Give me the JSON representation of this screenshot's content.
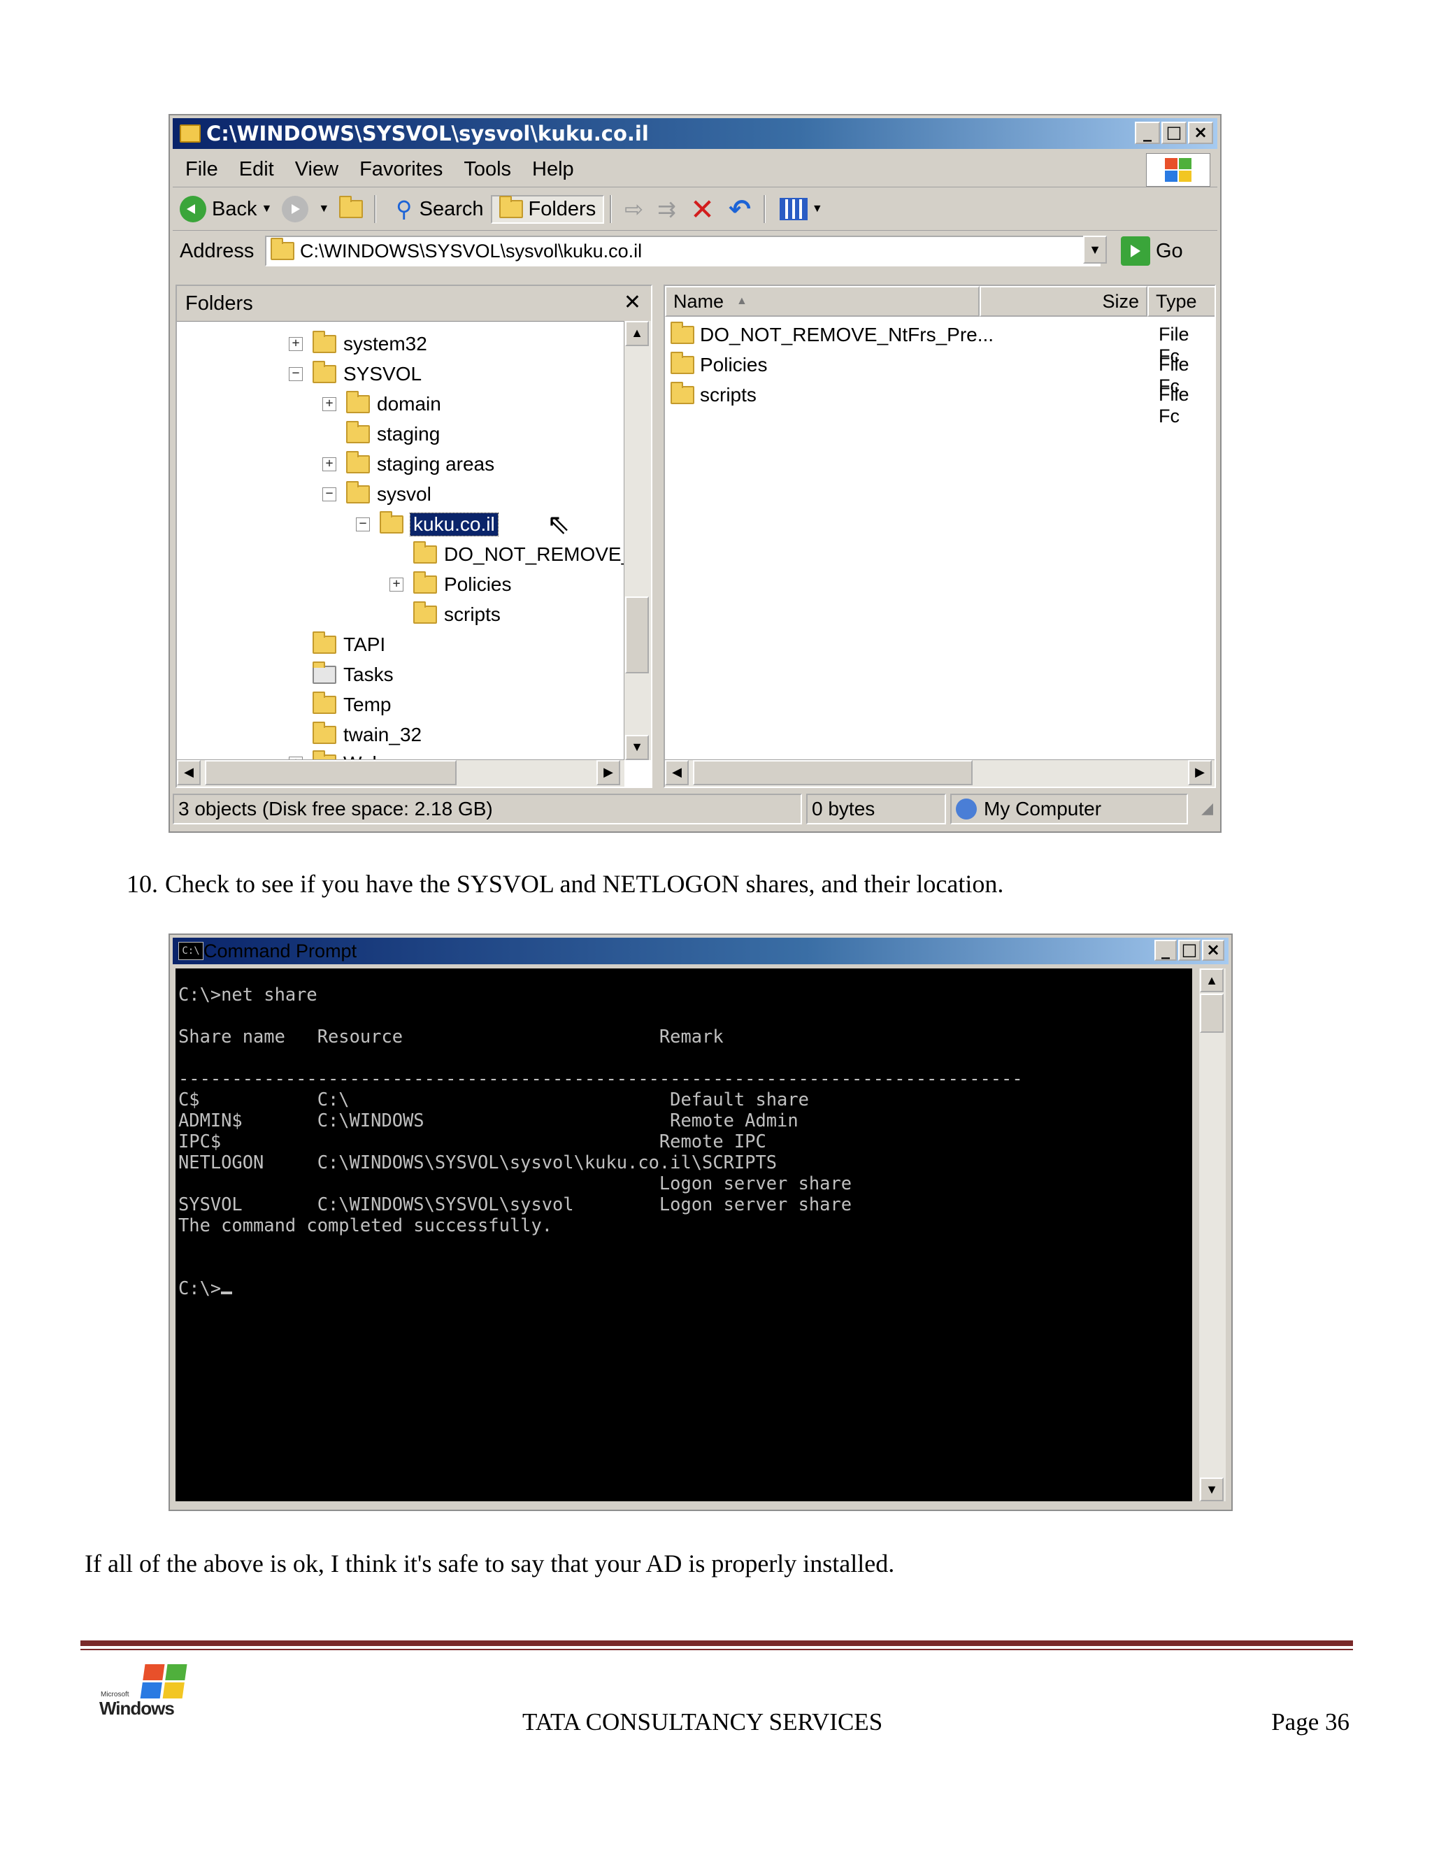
{
  "explorer": {
    "title": "C:\\WINDOWS\\SYSVOL\\sysvol\\kuku.co.il",
    "menu": [
      "File",
      "Edit",
      "View",
      "Favorites",
      "Tools",
      "Help"
    ],
    "toolbar": {
      "back": "Back",
      "search": "Search",
      "folders": "Folders"
    },
    "address_label": "Address",
    "address_value": "C:\\WINDOWS\\SYSVOL\\sysvol\\kuku.co.il",
    "go": "Go",
    "folders_header": "Folders",
    "tree": [
      {
        "label": "system32",
        "expander": "+"
      },
      {
        "label": "SYSVOL",
        "expander": "−"
      },
      {
        "label": "domain",
        "expander": "+"
      },
      {
        "label": "staging",
        "expander": ""
      },
      {
        "label": "staging areas",
        "expander": "+"
      },
      {
        "label": "sysvol",
        "expander": "−"
      },
      {
        "label": "kuku.co.il",
        "expander": "−",
        "selected": true
      },
      {
        "label": "DO_NOT_REMOVE_I",
        "expander": ""
      },
      {
        "label": "Policies",
        "expander": "+"
      },
      {
        "label": "scripts",
        "expander": ""
      },
      {
        "label": "TAPI",
        "expander": ""
      },
      {
        "label": "Tasks",
        "expander": ""
      },
      {
        "label": "Temp",
        "expander": ""
      },
      {
        "label": "twain_32",
        "expander": ""
      },
      {
        "label": "Web",
        "expander": "+"
      }
    ],
    "columns": {
      "name": "Name",
      "size": "Size",
      "type": "Type"
    },
    "files": [
      {
        "name": "DO_NOT_REMOVE_NtFrs_Pre...",
        "type": "File Fc"
      },
      {
        "name": "Policies",
        "type": "File Fc"
      },
      {
        "name": "scripts",
        "type": "File Fc"
      }
    ],
    "status": {
      "objects": "3 objects (Disk free space: 2.18 GB)",
      "bytes": "0 bytes",
      "location": "My Computer"
    }
  },
  "step": {
    "number": "10.",
    "text": "Check to see if you have the SYSVOL and NETLOGON shares, and their location."
  },
  "cmd": {
    "title": "Command Prompt",
    "icon_text": "C:\\",
    "output": "C:\\>net share\n\nShare name   Resource                        Remark\n\n-------------------------------------------------------------------------------\nC$           C:\\                              Default share\nADMIN$       C:\\WINDOWS                       Remote Admin\nIPC$                                         Remote IPC\nNETLOGON     C:\\WINDOWS\\SYSVOL\\sysvol\\kuku.co.il\\SCRIPTS\n                                             Logon server share\nSYSVOL       C:\\WINDOWS\\SYSVOL\\sysvol        Logon server share\nThe command completed successfully.\n\n\nC:\\>"
  },
  "conclusion": "If all of the above is ok, I think it's safe to say that your AD is properly installed.",
  "footer": {
    "logo_small": "Microsoft",
    "logo_text": "Windows",
    "center": "TATA CONSULTANCY SERVICES",
    "page": "Page 36"
  }
}
